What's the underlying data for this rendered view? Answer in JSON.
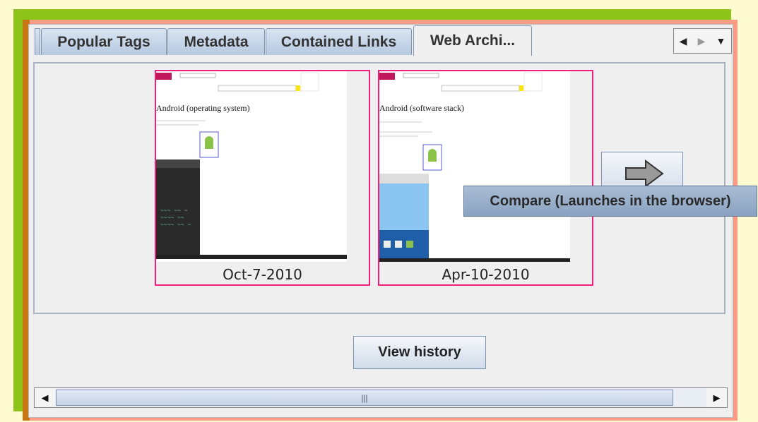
{
  "tabs": [
    {
      "label": "Popular Tags",
      "active": false
    },
    {
      "label": "Metadata",
      "active": false
    },
    {
      "label": "Contained Links",
      "active": false
    },
    {
      "label": "Web Archi...",
      "active": true
    }
  ],
  "tab_nav": {
    "prev": "◀",
    "next": "▶",
    "menu": "▼"
  },
  "snapshots": [
    {
      "date": "Oct-7-2010",
      "page_title": "Android (operating system)"
    },
    {
      "date": "Apr-10-2010",
      "page_title": "Android (software stack)"
    }
  ],
  "compare_tooltip": "Compare (Launches in the browser)",
  "view_history_label": "View history",
  "scrollbar": {
    "left": "◀",
    "right": "▶",
    "grip": "|||"
  },
  "colors": {
    "accent_border": "#ef1f7a",
    "tab_gradient": "#b6c9e0",
    "tooltip": "#8aa3c2"
  }
}
